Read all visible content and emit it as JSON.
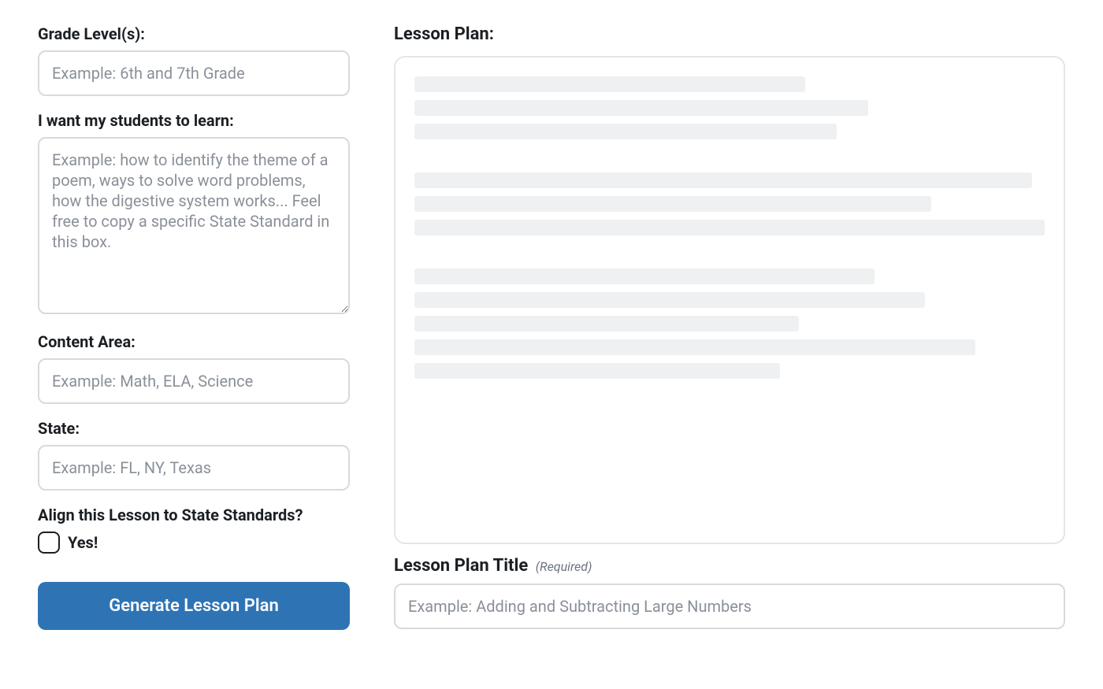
{
  "left": {
    "grade_level": {
      "label": "Grade Level(s):",
      "placeholder": "Example: 6th and 7th Grade",
      "value": ""
    },
    "learn": {
      "label": "I want my students to learn:",
      "placeholder": "Example: how to identify the theme of a poem, ways to solve word problems, how the digestive system works... Feel free to copy a specific State Standard in this box.",
      "value": ""
    },
    "content_area": {
      "label": "Content Area:",
      "placeholder": "Example: Math, ELA, Science",
      "value": ""
    },
    "state": {
      "label": "State:",
      "placeholder": "Example: FL, NY, Texas",
      "value": ""
    },
    "align": {
      "label": "Align this Lesson to State Standards?",
      "checkbox_label": "Yes!",
      "checked": false
    },
    "generate_button": "Generate Lesson Plan"
  },
  "right": {
    "output_label": "Lesson Plan:",
    "title": {
      "label": "Lesson Plan Title",
      "required_note": "(Required)",
      "placeholder": "Example: Adding and Subtracting Large Numbers",
      "value": ""
    },
    "skeleton": {
      "groups": [
        {
          "lines": [
            62,
            72,
            67
          ]
        },
        {
          "lines": [
            98,
            82,
            100
          ]
        },
        {
          "lines": [
            73,
            81,
            61,
            89,
            58
          ]
        }
      ]
    }
  }
}
